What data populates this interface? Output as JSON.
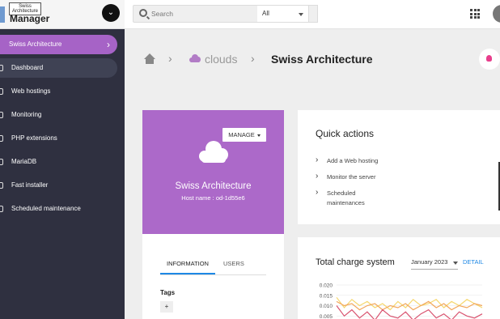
{
  "brand": {
    "small_text": "Swiss\nArchitecture",
    "title": "Manager"
  },
  "sidebar": {
    "items": [
      {
        "label": "Swiss Architecture",
        "icon": "server-icon"
      },
      {
        "label": "Dashboard",
        "icon": "dashboard-icon"
      },
      {
        "label": "Web hostings",
        "icon": "globe-icon"
      },
      {
        "label": "Monitoring",
        "icon": "monitor-icon"
      },
      {
        "label": "PHP extensions",
        "icon": "puzzle-icon"
      },
      {
        "label": "MariaDB",
        "icon": "database-icon"
      },
      {
        "label": "Fast installer",
        "icon": "rocket-icon"
      },
      {
        "label": "Scheduled maintenance",
        "icon": "calendar-icon"
      }
    ]
  },
  "topbar": {
    "search_placeholder": "Search",
    "filter_value": "All"
  },
  "breadcrumb": {
    "parent": "clouds",
    "current": "Swiss Architecture"
  },
  "hero": {
    "manage_label": "MANAGE",
    "title": "Swiss Architecture",
    "host": "Host name : od-1d55e6",
    "color": "#ac69c9"
  },
  "info": {
    "tabs": [
      "INFORMATION",
      "USERS"
    ],
    "tags_label": "Tags",
    "add_tag": "+"
  },
  "quick_actions": {
    "title": "Quick actions",
    "items": [
      "Add a Web hosting",
      "Monitor the server",
      "Scheduled maintenances"
    ]
  },
  "charge": {
    "title": "Total charge system",
    "month": "January 2023",
    "detail_label": "DETAIL"
  },
  "chart_data": {
    "type": "line",
    "ylim": [
      0,
      0.02
    ],
    "yticks": [
      "0.020",
      "0.015",
      "0.010",
      "0.005"
    ],
    "series": [
      {
        "color": "#f5d76e",
        "values": [
          0.014,
          0.009,
          0.013,
          0.01,
          0.012,
          0.009,
          0.011,
          0.008,
          0.012,
          0.009,
          0.013,
          0.01,
          0.011,
          0.013,
          0.009,
          0.012,
          0.01,
          0.013,
          0.011,
          0.009
        ]
      },
      {
        "color": "#f2a65a",
        "values": [
          0.012,
          0.01,
          0.011,
          0.008,
          0.01,
          0.011,
          0.008,
          0.01,
          0.009,
          0.011,
          0.008,
          0.01,
          0.012,
          0.009,
          0.011,
          0.008,
          0.01,
          0.009,
          0.011,
          0.01
        ]
      },
      {
        "color": "#d9536f",
        "values": [
          0.01,
          0.005,
          0.008,
          0.004,
          0.007,
          0.003,
          0.008,
          0.005,
          0.004,
          0.007,
          0.003,
          0.006,
          0.008,
          0.004,
          0.006,
          0.003,
          0.007,
          0.005,
          0.004,
          0.006
        ]
      }
    ]
  }
}
